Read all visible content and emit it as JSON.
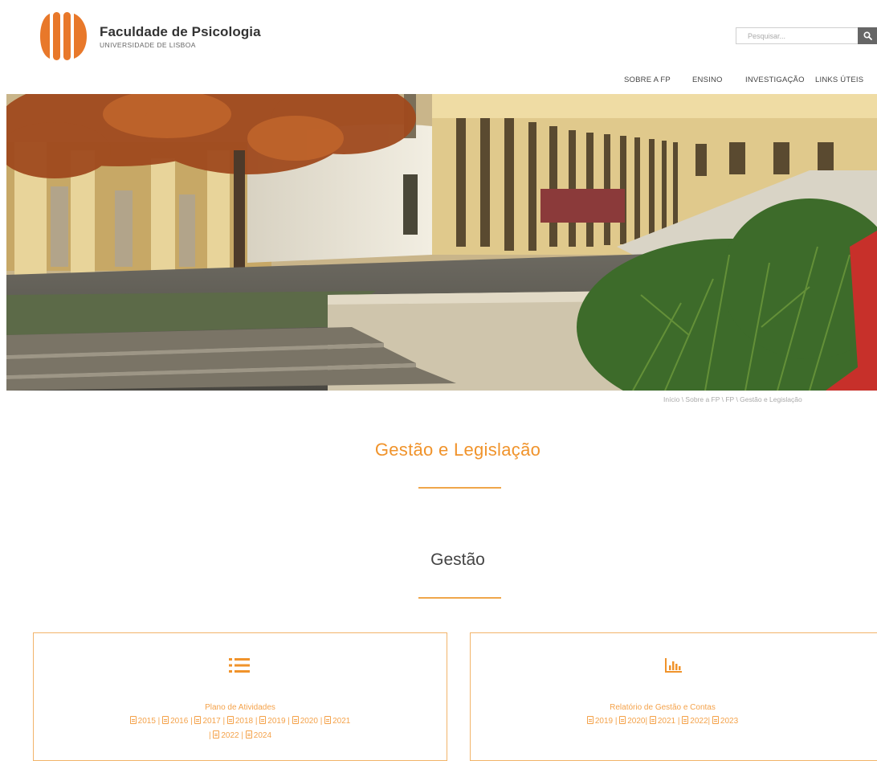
{
  "header": {
    "title": "Faculdade de Psicologia",
    "subtitle": "UNIVERSIDADE DE LISBOA",
    "search_placeholder": "Pesquisar..."
  },
  "nav": {
    "items": [
      "SOBRE A FP",
      "ENSINO",
      "INVESTIGAÇÃO",
      "LINKS ÚTEIS"
    ]
  },
  "breadcrumb": {
    "items": [
      "Início",
      "Sobre a FP",
      "FP",
      "Gestão e Legislação"
    ],
    "separator": " \\ "
  },
  "page": {
    "title": "Gestão e Legislação",
    "section": "Gestão"
  },
  "cards": [
    {
      "icon": "list-icon",
      "title": "Plano de Atividades",
      "line1": [
        "2015",
        "2016",
        "2017",
        "2018",
        "2019",
        "2020",
        "2021"
      ],
      "line2": [
        "2022",
        "2024"
      ]
    },
    {
      "icon": "bar-chart-icon",
      "title": "Relatório de Gestão e Contas",
      "line1": [
        "2019",
        "2020",
        "2021",
        "2022",
        "2023"
      ]
    }
  ],
  "colors": {
    "accent": "#f0932b",
    "logo": "#e8782a",
    "text": "#333333"
  }
}
